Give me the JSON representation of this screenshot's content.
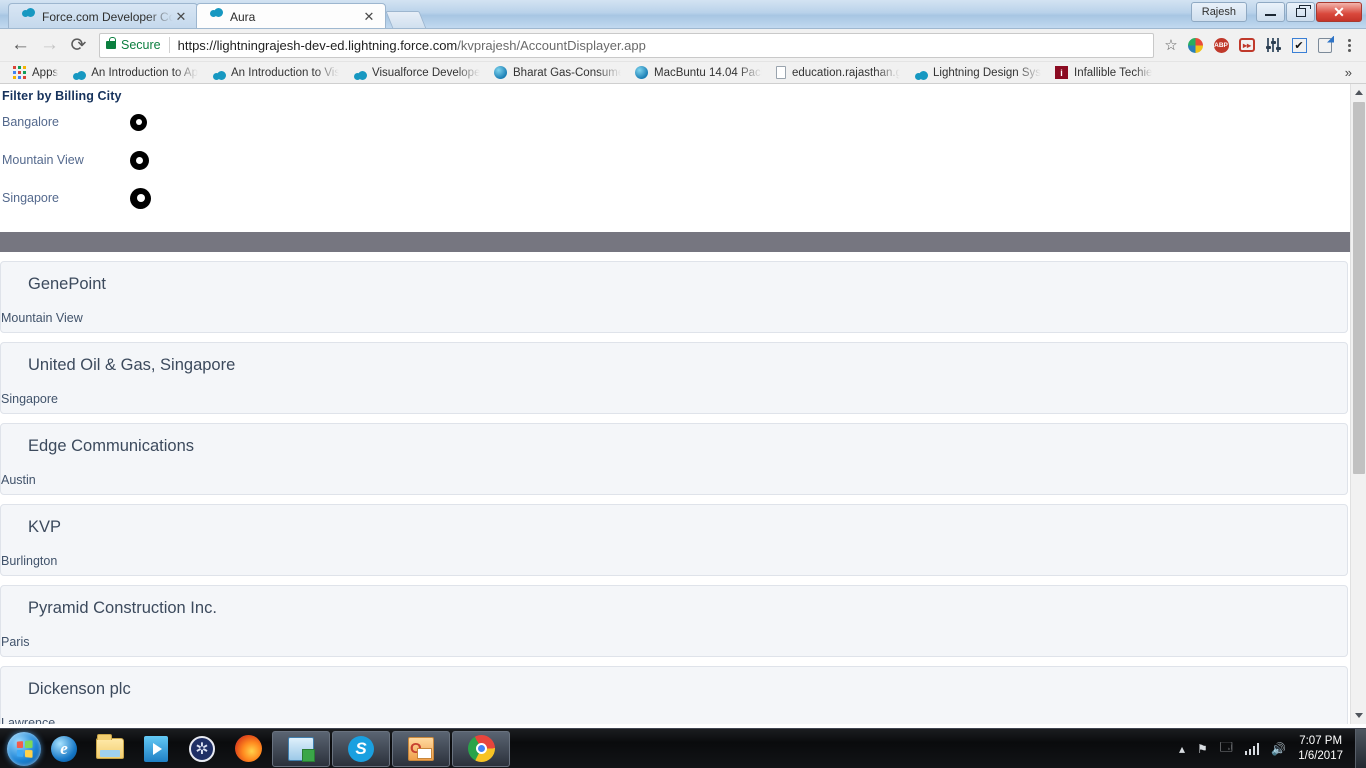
{
  "browser": {
    "tabs": [
      {
        "title": "Force.com Developer Co",
        "favicon": "salesforce-cloud-icon",
        "active": false
      },
      {
        "title": "Aura",
        "favicon": "salesforce-cloud-icon",
        "active": true
      }
    ],
    "new_tab_label": "",
    "profile_label": "Rajesh",
    "window_buttons": {
      "minimize": "–",
      "restore": "❐",
      "close": "✕"
    },
    "nav": {
      "back": "←",
      "forward": "→",
      "reload": "⟳"
    },
    "omnibox": {
      "security_label": "Secure",
      "url_host": "https://lightningrajesh-dev-ed.lightning.force.com",
      "url_path": "/kvprajesh/AccountDisplayer.app",
      "star": "☆"
    },
    "extensions": [
      {
        "name": "color-wheel-extension-icon"
      },
      {
        "name": "adblock-plus-icon",
        "text": "ABP"
      },
      {
        "name": "fast-forward-extension-icon",
        "text": "▸▸"
      },
      {
        "name": "sliders-extension-icon"
      },
      {
        "name": "checkbox-extension-icon",
        "text": "✔"
      },
      {
        "name": "note-extension-icon"
      }
    ],
    "menu": "⋮",
    "bookmarks": [
      {
        "label": "Apps",
        "icon": "apps-grid-icon"
      },
      {
        "label": "An Introduction to Ap",
        "icon": "salesforce-cloud-icon"
      },
      {
        "label": "An Introduction to Vis",
        "icon": "salesforce-cloud-icon"
      },
      {
        "label": "Visualforce Developer",
        "icon": "salesforce-cloud-icon"
      },
      {
        "label": "Bharat Gas-Consumer",
        "icon": "globe-icon"
      },
      {
        "label": "MacBuntu 14.04 Pack",
        "icon": "globe-icon"
      },
      {
        "label": "education.rajasthan.g",
        "icon": "document-icon"
      },
      {
        "label": "Lightning Design Syst",
        "icon": "salesforce-cloud-icon"
      },
      {
        "label": "Infallible Techie",
        "icon": "info-icon"
      }
    ],
    "bookmarks_overflow": "»"
  },
  "page": {
    "filter_title": "Filter by Billing City",
    "filter_options": [
      {
        "label": "Bangalore",
        "dot_size": 17,
        "inner": 6
      },
      {
        "label": "Mountain View",
        "dot_size": 19,
        "inner": 7
      },
      {
        "label": "Singapore",
        "dot_size": 21,
        "inner": 8
      }
    ],
    "accounts": [
      {
        "name": "GenePoint",
        "city": "Mountain View"
      },
      {
        "name": "United Oil & Gas, Singapore",
        "city": "Singapore"
      },
      {
        "name": "Edge Communications",
        "city": "Austin"
      },
      {
        "name": "KVP",
        "city": "Burlington"
      },
      {
        "name": "Pyramid Construction Inc.",
        "city": "Paris"
      },
      {
        "name": "Dickenson plc",
        "city": "Lawrence"
      }
    ],
    "colors": {
      "header_bar": "#767680",
      "card_bg": "#f4f6f9",
      "card_border": "#dfe3ea",
      "title_text": "#16325c",
      "label_text": "#54698d"
    }
  },
  "taskbar": {
    "start": "windows-start-orb",
    "items": [
      {
        "name": "internet-explorer-icon"
      },
      {
        "name": "file-explorer-icon"
      },
      {
        "name": "windows-media-player-icon"
      },
      {
        "name": "sourcetree-icon"
      },
      {
        "name": "firefox-icon"
      },
      {
        "name": "excel-window-icon"
      },
      {
        "name": "skype-window-icon"
      },
      {
        "name": "outlook-window-icon"
      },
      {
        "name": "chrome-window-icon"
      }
    ],
    "tray": {
      "overflow": "▴",
      "flag": "⚑",
      "action_center": "🗔",
      "network": "signal-bars-icon",
      "volume": "🔊"
    },
    "clock_time": "7:07 PM",
    "clock_date": "1/6/2017"
  }
}
